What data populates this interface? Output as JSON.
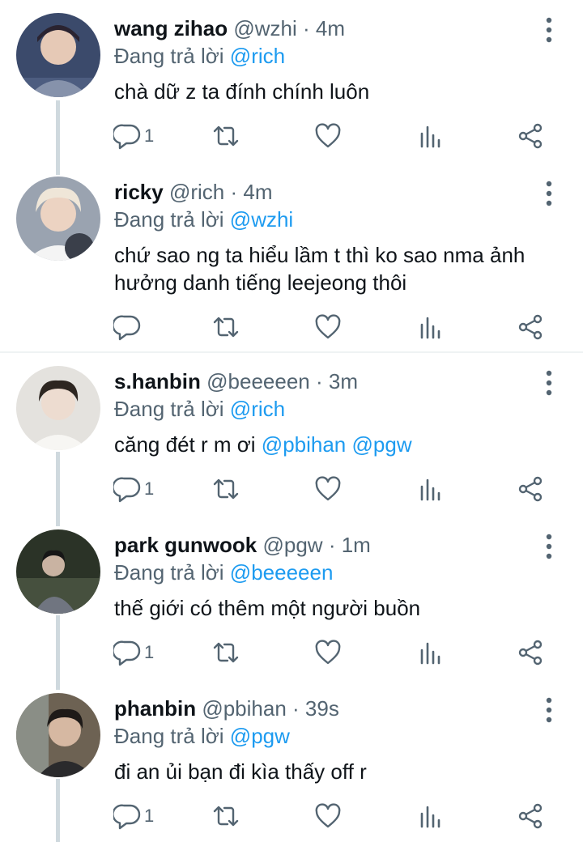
{
  "tweets": [
    {
      "name": "wang zihao",
      "handle": "@wzhi",
      "time": "· 4m",
      "reply_prefix": "Đang trả lời",
      "reply_to": "@rich",
      "text": "chà dữ z ta đính chính luôn",
      "reply_count": "1"
    },
    {
      "name": "ricky",
      "handle": "@rich",
      "time": "· 4m",
      "reply_prefix": "Đang trả lời",
      "reply_to": "@wzhi",
      "text": "chứ sao ng ta hiểu lầm t thì ko sao nma ảnh hưởng danh tiếng leejeong thôi",
      "reply_count": ""
    },
    {
      "name": "s.hanbin",
      "handle": "@beeeeen",
      "time": "· 3m",
      "reply_prefix": "Đang trả lời",
      "reply_to": "@rich",
      "text_plain": "căng đét r m ơi ",
      "text_mention1": "@pbihan",
      "text_mention2": "@pgw",
      "reply_count": "1"
    },
    {
      "name": "park gunwook",
      "handle": "@pgw",
      "time": "· 1m",
      "reply_prefix": "Đang trả lời",
      "reply_to": "@beeeeen",
      "text": "thế giới có thêm một người buồn",
      "reply_count": "1"
    },
    {
      "name": "phanbin",
      "handle": "@pbihan",
      "time": "· 39s",
      "reply_prefix": "Đang trả lời",
      "reply_to": "@pgw",
      "text": "đi an ủi bạn đi kìa thấy off r",
      "reply_count": "1"
    }
  ],
  "colors": {
    "accent": "#1d9bf0",
    "secondary_text": "#536471",
    "thread_line": "#cfd9de"
  },
  "icons": [
    "more-vertical-icon",
    "reply-icon",
    "retweet-icon",
    "like-icon",
    "views-icon",
    "share-icon"
  ]
}
